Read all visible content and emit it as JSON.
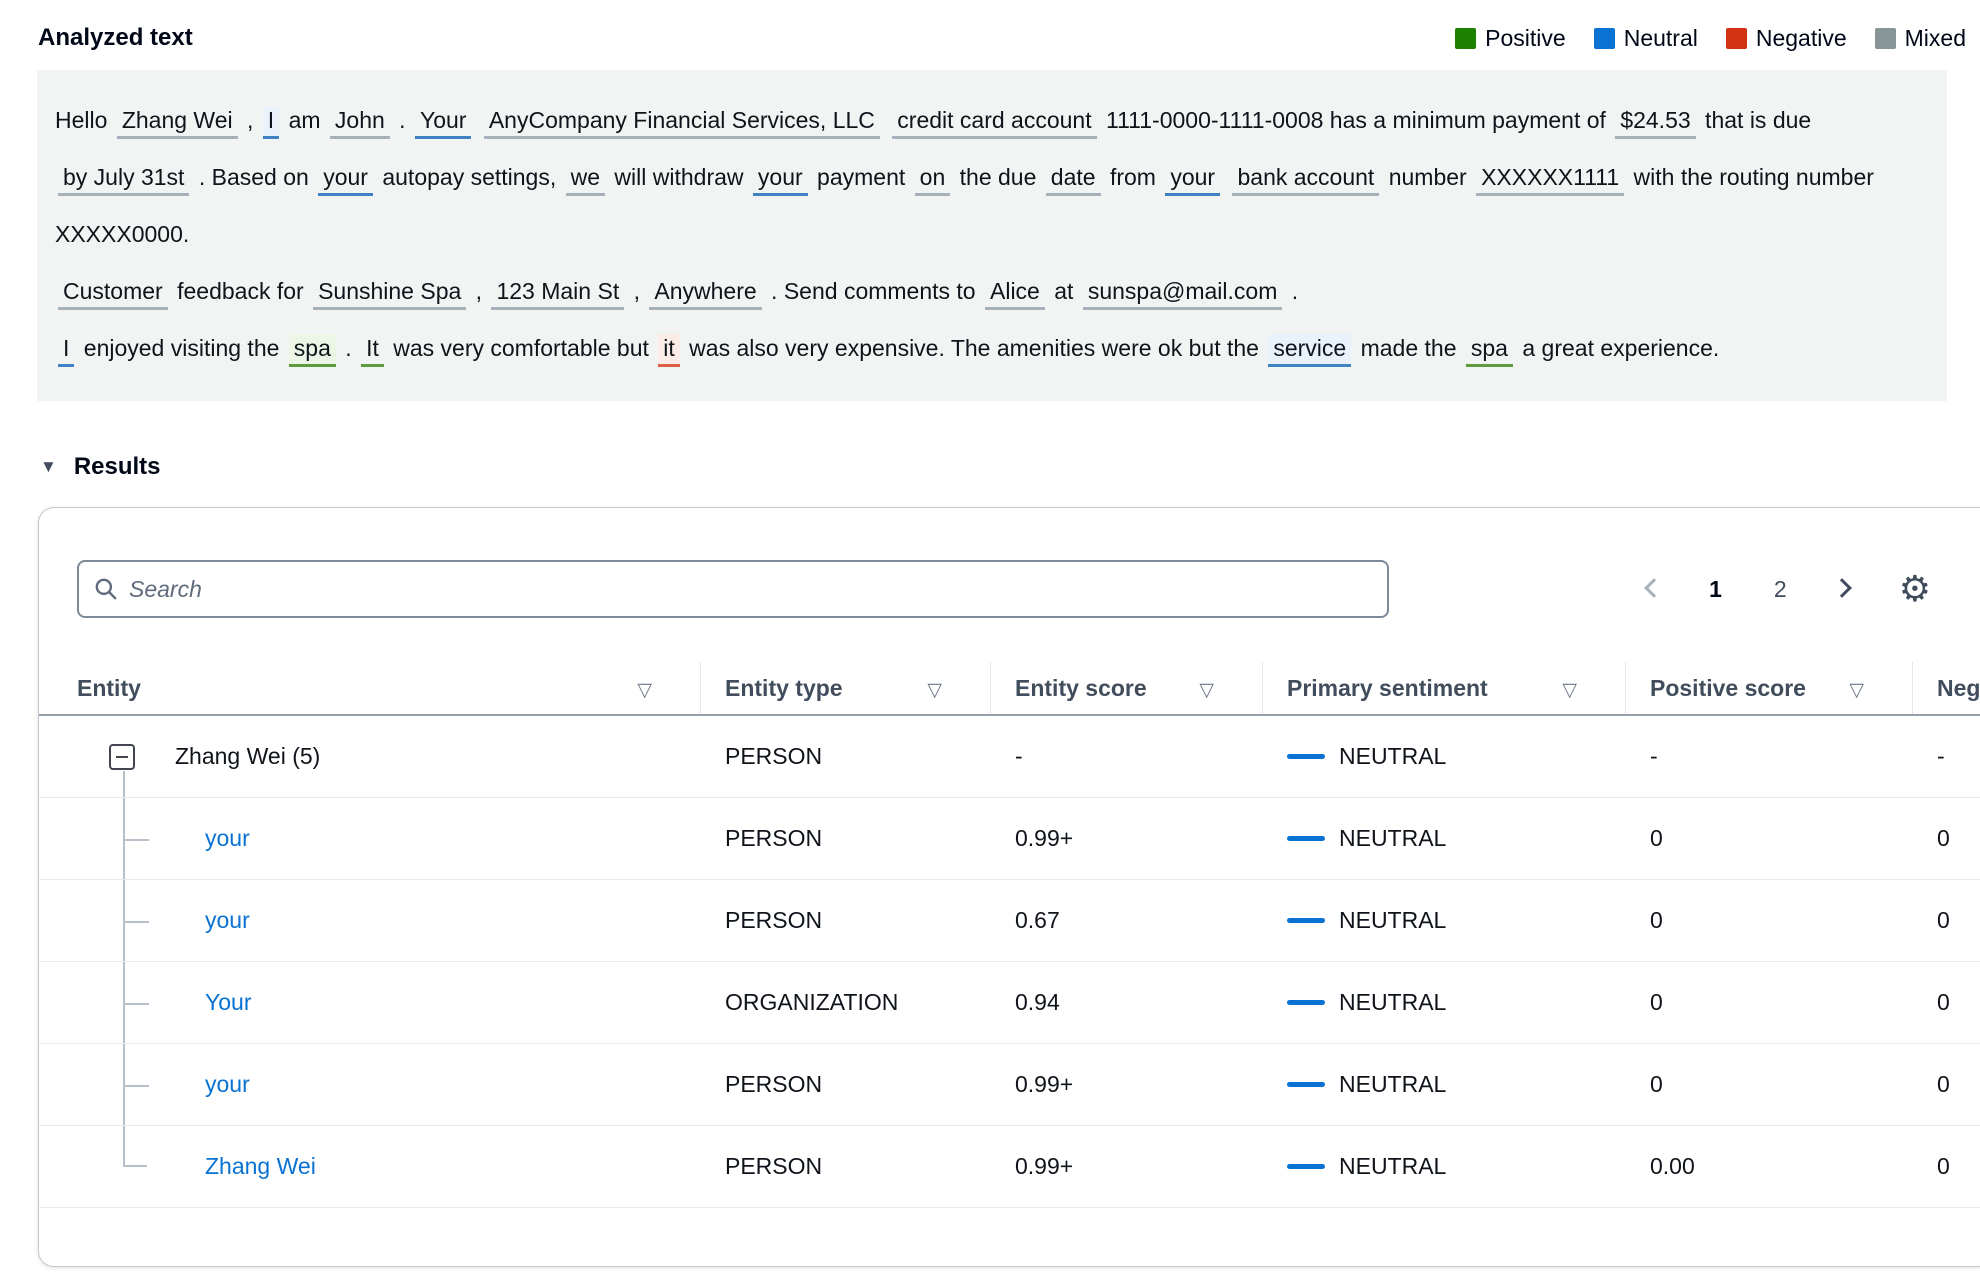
{
  "header": {
    "title": "Analyzed text",
    "legend": [
      {
        "label": "Positive",
        "color": "#1d8102"
      },
      {
        "label": "Neutral",
        "color": "#0972d3"
      },
      {
        "label": "Negative",
        "color": "#d13212"
      },
      {
        "label": "Mixed",
        "color": "#879596"
      }
    ]
  },
  "analyzed_text": {
    "paragraphs": [
      {
        "segments": [
          {
            "text": "Hello "
          },
          {
            "text": "Zhang Wei",
            "entity": true,
            "sentiment": "none"
          },
          {
            "text": " , "
          },
          {
            "text": "I",
            "entity": true,
            "sentiment": "neutral",
            "bg": true
          },
          {
            "text": " am "
          },
          {
            "text": "John",
            "entity": true,
            "sentiment": "none"
          },
          {
            "text": " . "
          },
          {
            "text": "Your",
            "entity": true,
            "sentiment": "neutral"
          },
          {
            "text": " "
          },
          {
            "text": "AnyCompany Financial Services, LLC",
            "entity": true,
            "sentiment": "none"
          },
          {
            "text": " "
          },
          {
            "text": "credit card account",
            "entity": true,
            "sentiment": "none"
          },
          {
            "text": " 1111-0000-1111-0008 has a minimum payment of "
          },
          {
            "text": "$24.53",
            "entity": true,
            "sentiment": "none"
          },
          {
            "text": " that is due "
          },
          {
            "text": "by July 31st",
            "entity": true,
            "sentiment": "none"
          },
          {
            "text": " . Based on "
          },
          {
            "text": "your",
            "entity": true,
            "sentiment": "neutral"
          },
          {
            "text": " autopay settings, "
          },
          {
            "text": "we",
            "entity": true,
            "sentiment": "none"
          },
          {
            "text": " will withdraw "
          },
          {
            "text": "your",
            "entity": true,
            "sentiment": "neutral"
          },
          {
            "text": " payment "
          },
          {
            "text": "on",
            "entity": true,
            "sentiment": "none"
          },
          {
            "text": " the due "
          },
          {
            "text": "date",
            "entity": true,
            "sentiment": "none"
          },
          {
            "text": " from "
          },
          {
            "text": "your",
            "entity": true,
            "sentiment": "neutral"
          },
          {
            "text": " "
          },
          {
            "text": "bank account",
            "entity": true,
            "sentiment": "none"
          },
          {
            "text": " number "
          },
          {
            "text": "XXXXXX1111",
            "entity": true,
            "sentiment": "none"
          },
          {
            "text": " with the routing number XXXXX0000."
          }
        ]
      },
      {
        "segments": [
          {
            "text": "Customer",
            "entity": true,
            "sentiment": "none"
          },
          {
            "text": " feedback for "
          },
          {
            "text": "Sunshine Spa",
            "entity": true,
            "sentiment": "none"
          },
          {
            "text": " , "
          },
          {
            "text": "123 Main St",
            "entity": true,
            "sentiment": "none"
          },
          {
            "text": " , "
          },
          {
            "text": "Anywhere",
            "entity": true,
            "sentiment": "none"
          },
          {
            "text": " . Send comments to "
          },
          {
            "text": "Alice",
            "entity": true,
            "sentiment": "none"
          },
          {
            "text": " at "
          },
          {
            "text": "sunspa@mail.com",
            "entity": true,
            "sentiment": "none"
          },
          {
            "text": " ."
          }
        ]
      },
      {
        "segments": [
          {
            "text": "I",
            "entity": true,
            "sentiment": "neutral"
          },
          {
            "text": " enjoyed visiting the "
          },
          {
            "text": "spa",
            "entity": true,
            "sentiment": "positive",
            "bg": true
          },
          {
            "text": " . "
          },
          {
            "text": "It",
            "entity": true,
            "sentiment": "positive"
          },
          {
            "text": " was very comfortable but "
          },
          {
            "text": "it",
            "entity": true,
            "sentiment": "negative",
            "bg": true
          },
          {
            "text": " was also very expensive. The amenities were ok but the "
          },
          {
            "text": "service",
            "entity": true,
            "sentiment": "neutral",
            "bg": true
          },
          {
            "text": " made the "
          },
          {
            "text": "spa",
            "entity": true,
            "sentiment": "positive"
          },
          {
            "text": " a great experience."
          }
        ]
      }
    ]
  },
  "results": {
    "title": "Results",
    "search_placeholder": "Search",
    "pagination": {
      "pages": [
        "1",
        "2"
      ],
      "current": "1"
    },
    "icons": {
      "search": "magnifier",
      "previous": "chevron-left",
      "next": "chevron-right",
      "settings": "gear",
      "sort": "triangle-down",
      "collapse_results": "triangle-down-filled",
      "collapse_group": "minus-box"
    },
    "table": {
      "columns": [
        "Entity",
        "Entity type",
        "Entity score",
        "Primary sentiment",
        "Positive score",
        "Negative score"
      ],
      "rows": [
        {
          "entity": "Zhang Wei (5)",
          "parent": true,
          "type": "PERSON",
          "score": "-",
          "sentiment": "NEUTRAL",
          "positive_score": "-",
          "negative_score": "-"
        },
        {
          "entity": "your",
          "type": "PERSON",
          "score": "0.99+",
          "sentiment": "NEUTRAL",
          "positive_score": "0",
          "negative_score": "0"
        },
        {
          "entity": "your",
          "type": "PERSON",
          "score": "0.67",
          "sentiment": "NEUTRAL",
          "positive_score": "0",
          "negative_score": "0"
        },
        {
          "entity": "Your",
          "type": "ORGANIZATION",
          "score": "0.94",
          "sentiment": "NEUTRAL",
          "positive_score": "0",
          "negative_score": "0"
        },
        {
          "entity": "your",
          "type": "PERSON",
          "score": "0.99+",
          "sentiment": "NEUTRAL",
          "positive_score": "0",
          "negative_score": "0"
        },
        {
          "entity": "Zhang Wei",
          "type": "PERSON",
          "score": "0.99+",
          "last": true,
          "sentiment": "NEUTRAL",
          "positive_score": "0.00",
          "negative_score": "0"
        }
      ]
    }
  }
}
